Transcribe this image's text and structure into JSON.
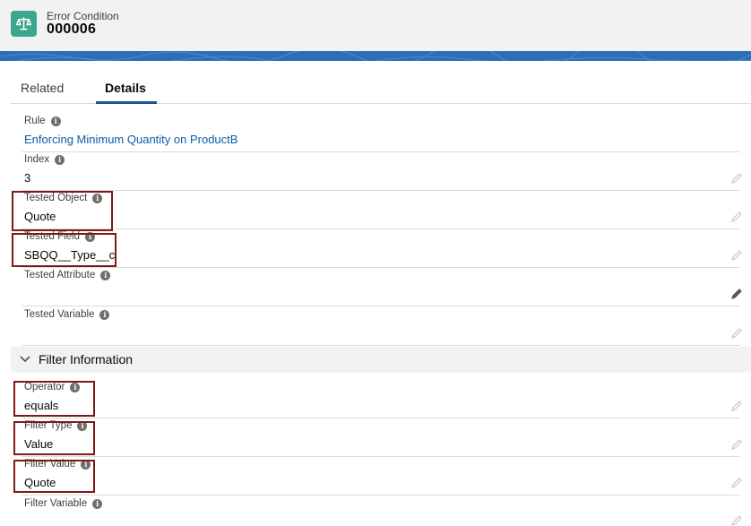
{
  "header": {
    "object_type": "Error Condition",
    "record_name": "000006",
    "icon": "scales-icon",
    "icon_color": "#3ba88e",
    "banner_color": "#2e6eb5"
  },
  "tabs": [
    {
      "label": "Related",
      "active": false
    },
    {
      "label": "Details",
      "active": true
    }
  ],
  "fields": {
    "rule": {
      "label": "Rule",
      "value": "Enforcing Minimum Quantity on ProductB"
    },
    "index": {
      "label": "Index",
      "value": "3"
    },
    "tested_object": {
      "label": "Tested Object",
      "value": "Quote"
    },
    "tested_field": {
      "label": "Tested Field",
      "value": "SBQQ__Type__c"
    },
    "tested_attribute": {
      "label": "Tested Attribute",
      "value": ""
    },
    "tested_variable": {
      "label": "Tested Variable",
      "value": ""
    }
  },
  "filter_section": {
    "title": "Filter Information",
    "fields": {
      "operator": {
        "label": "Operator",
        "value": "equals"
      },
      "filter_type": {
        "label": "Filter Type",
        "value": "Value"
      },
      "filter_value": {
        "label": "Filter Value",
        "value": "Quote"
      },
      "filter_variable": {
        "label": "Filter Variable",
        "value": ""
      }
    }
  },
  "colors": {
    "link": "#0b5cab",
    "highlight_box": "#7d1a17",
    "tab_underline": "#1b5297"
  }
}
